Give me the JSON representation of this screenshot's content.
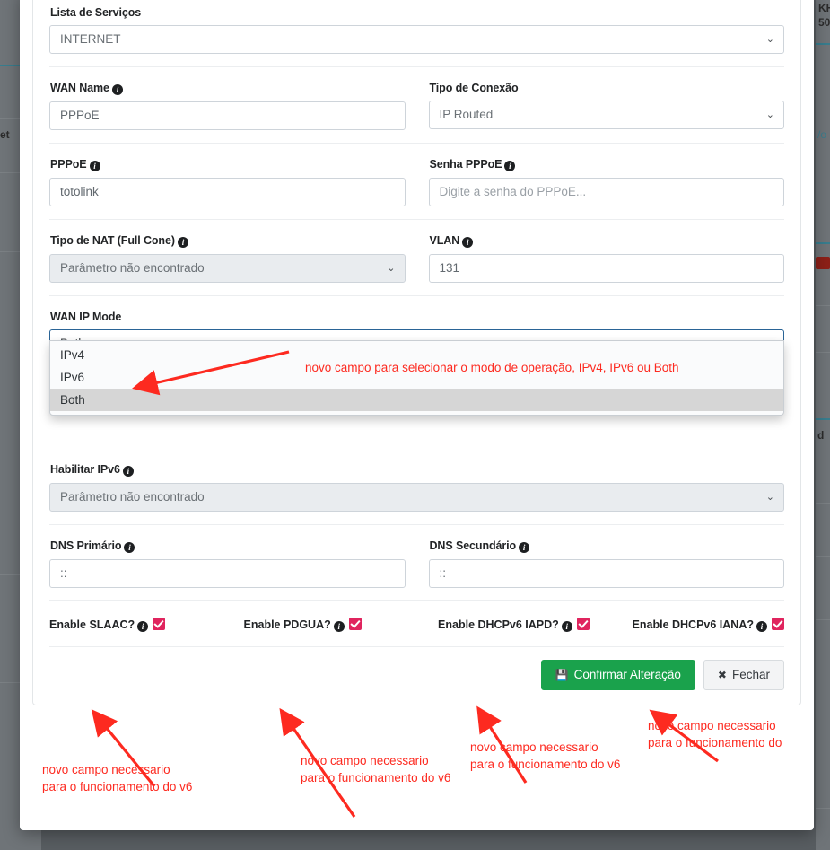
{
  "modal": {
    "fields": {
      "service_list": {
        "label": "Lista de Serviços",
        "value": "INTERNET",
        "caret": "⌄"
      },
      "wan_name": {
        "label": "WAN Name",
        "info": "i",
        "value": "PPPoE"
      },
      "connection_type": {
        "label": "Tipo de Conexão",
        "value": "IP Routed",
        "caret": "⌄"
      },
      "pppoe": {
        "label": "PPPoE",
        "info": "i",
        "value": "totolink"
      },
      "pppoe_password": {
        "label": "Senha PPPoE",
        "info": "i",
        "placeholder": "Digite a senha do PPPoE...",
        "value": ""
      },
      "nat_type": {
        "label": "Tipo de NAT (Full Cone)",
        "info": "i",
        "value": "Parâmetro não encontrado",
        "caret": "⌄",
        "disabled": true
      },
      "vlan": {
        "label": "VLAN",
        "info": "i",
        "value": "131"
      },
      "wan_ip_mode": {
        "label": "WAN IP Mode",
        "value": "Both",
        "caret": "⌄",
        "options": [
          "IPv4",
          "IPv6",
          "Both"
        ],
        "selected_option": "Both"
      },
      "enable_ipv6": {
        "label": "Habilitar IPv6",
        "info": "i",
        "value": "Parâmetro não encontrado",
        "caret": "⌄",
        "disabled": true
      },
      "dns_primary": {
        "label": "DNS Primário",
        "info": "i",
        "value": "::"
      },
      "dns_secondary": {
        "label": "DNS Secundário",
        "info": "i",
        "value": "::"
      }
    },
    "checkboxes": [
      {
        "label": "Enable SLAAC?",
        "info": "i",
        "checked": true
      },
      {
        "label": "Enable PDGUA?",
        "info": "i",
        "checked": true
      },
      {
        "label": "Enable DHCPv6 IAPD?",
        "info": "i",
        "checked": true
      },
      {
        "label": "Enable DHCPv6 IANA?",
        "info": "i",
        "checked": true
      }
    ],
    "footer": {
      "confirm_label": "Confirmar Alteração",
      "confirm_icon": "💾",
      "close_label": "Fechar",
      "close_icon": "✖"
    }
  },
  "annotations": [
    {
      "id": "wan_ip_mode_note",
      "text": "novo campo para selecionar o modo de operação, IPv4, IPv6 ou Both"
    },
    {
      "id": "slaac_note",
      "text": "novo campo necessario\npara o funcionamento do v6"
    },
    {
      "id": "pdgua_note",
      "text": "novo campo necessario\npara o funcionamento do v6"
    },
    {
      "id": "iapd_note",
      "text": "novo campo necessario\npara o funcionamento do v6"
    },
    {
      "id": "iana_note",
      "text": "novo campo necessario\npara o funcionamento do"
    }
  ],
  "background": {
    "snippets": [
      "KH",
      "50",
      "et",
      "/o",
      "d"
    ]
  },
  "colors": {
    "accent_green": "#1aa24c",
    "annotation_red": "#fd2a20",
    "checkbox_red": "#e0245e",
    "focus_blue": "#2a6496",
    "backdrop": "#585d61"
  }
}
